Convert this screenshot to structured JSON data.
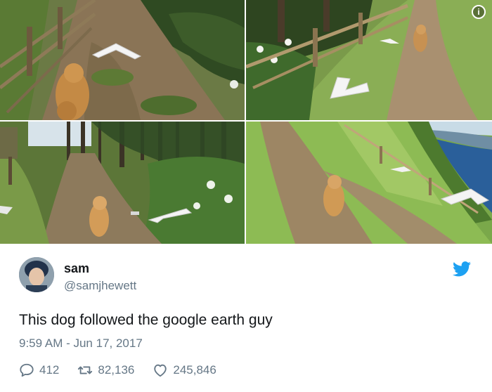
{
  "tweet": {
    "name": "sam",
    "handle": "@samjhewett",
    "text": "This dog followed the google earth guy",
    "timestamp": "9:59 AM - Jun 17, 2017",
    "replies": "412",
    "retweets": "82,136",
    "likes": "245,846"
  },
  "icons": {
    "info": "info-icon",
    "platform": "twitter-bird-icon",
    "reply": "reply-icon",
    "retweet": "retweet-icon",
    "like": "heart-icon"
  },
  "colors": {
    "twitter_blue": "#1da1f2",
    "meta_gray": "#657786",
    "text": "#14171a"
  },
  "photos": [
    {
      "label": "dog-on-trail-by-fence"
    },
    {
      "label": "dog-on-grassy-path"
    },
    {
      "label": "dog-on-forest-path"
    },
    {
      "label": "dog-on-coastal-hillside"
    }
  ]
}
